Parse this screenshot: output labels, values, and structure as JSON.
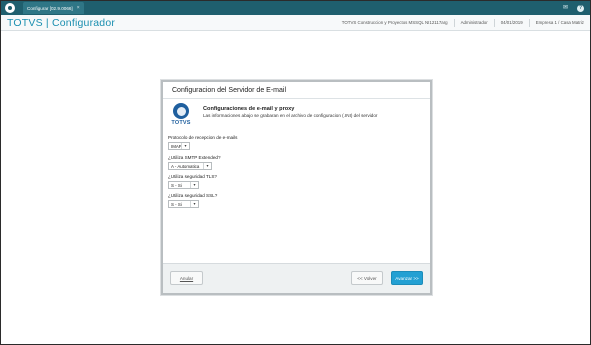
{
  "tab": {
    "title": "Configurar [02.9.0066]",
    "close": "×"
  },
  "header": {
    "brand": "TOTVS | Configurador",
    "company": "TOTVS Construccion y Proyectos MSSQL NI12117arg",
    "user": "Administrador",
    "date": "04/01/2019",
    "branch": "Empresa 1 / Casa Matriz"
  },
  "dialog": {
    "title": "Configuracion del Servidor de E-mail",
    "logo_text": "TOTVS",
    "intro_title": "Configuraciones de e-mail y proxy",
    "intro_desc": "Las informaciones abajo se grabaran en el archivo de configuracion (.INI) del servidor",
    "fields": [
      {
        "label": "Protocolo de recepcion de e-mails",
        "value": "IMAP"
      },
      {
        "label": "¿Utiliza SMTP Extended?",
        "value": "A - Automatica"
      },
      {
        "label": "¿Utiliza seguridad TLS?",
        "value": "S - Si"
      },
      {
        "label": "¿Utiliza seguridad SSL?",
        "value": "S - Si"
      }
    ],
    "buttons": {
      "anular": "Anular",
      "volver": "<< Volver",
      "avanzar": "Avanzar >>"
    }
  },
  "colors": {
    "topbar": "#1f5f6e",
    "brand": "#1b8fb0",
    "primary_button": "#23a0d3"
  },
  "icons": [
    "app-logo-icon",
    "mail-icon",
    "help-icon",
    "select-arrow-icon",
    "totvs-logo-icon"
  ]
}
